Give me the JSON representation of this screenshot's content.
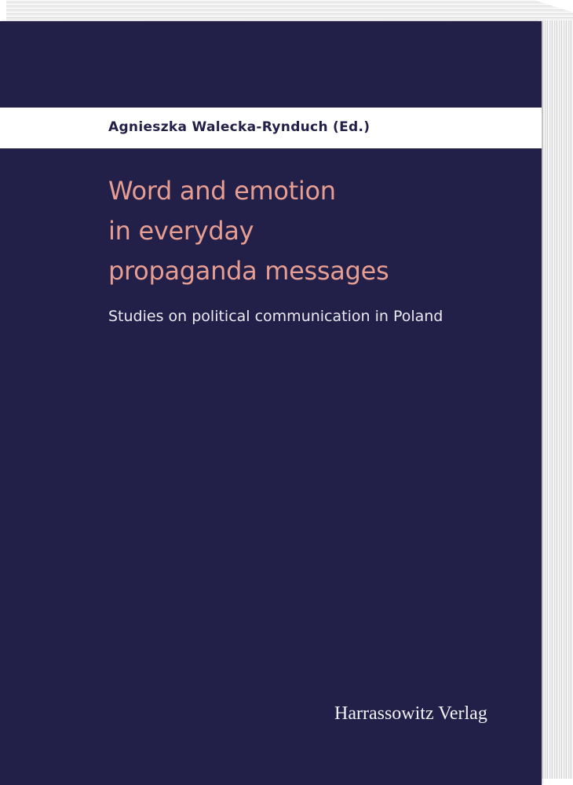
{
  "book": {
    "author": "Agnieszka Walecka-Rynduch (Ed.)",
    "title_lines": [
      "Word and emotion",
      "in everyday",
      "propaganda messages"
    ],
    "subtitle": "Studies on political communication in Poland",
    "publisher": "Harrassowitz Verlag"
  },
  "colors": {
    "cover_background": "#221f48",
    "author_band": "#ffffff",
    "title_text": "#e79e92",
    "subtitle_text": "#ece9f1"
  }
}
